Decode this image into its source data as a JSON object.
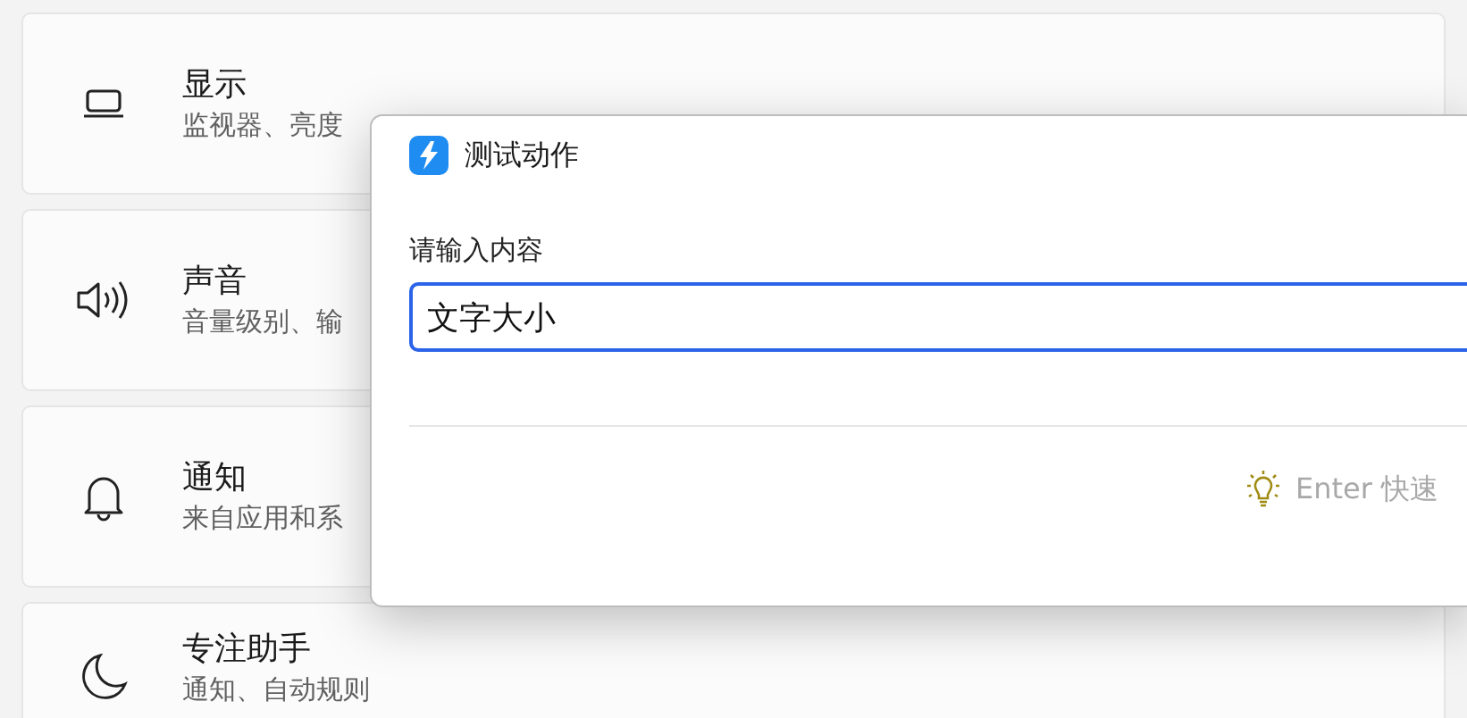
{
  "settings_items": [
    {
      "title": "显示",
      "subtitle": "监视器、亮度"
    },
    {
      "title": "声音",
      "subtitle": "音量级别、输"
    },
    {
      "title": "通知",
      "subtitle": "来自应用和系"
    },
    {
      "title": "专注助手",
      "subtitle": "通知、自动规则"
    }
  ],
  "dialog": {
    "title": "测试动作",
    "field_label": "请输入内容",
    "field_value": "文字大小",
    "hint": "Enter 快速"
  }
}
